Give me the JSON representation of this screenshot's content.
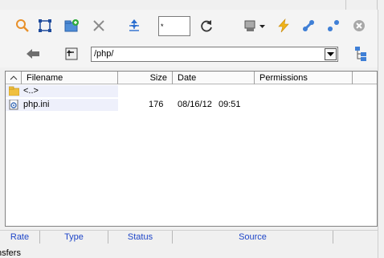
{
  "toolbar": {
    "filter_value": "*",
    "path_value": "/php/"
  },
  "columns": [
    "Filename",
    "Size",
    "Date",
    "Permissions"
  ],
  "files": [
    {
      "name": "<..>",
      "size": "",
      "date": "",
      "time": "",
      "icon": "folder-icon"
    },
    {
      "name": "php.ini",
      "size": "176",
      "date": "08/16/12",
      "time": "09:51",
      "icon": "file-config-icon"
    }
  ],
  "queue": {
    "columns": [
      "Rate",
      "Type",
      "Status",
      "Source"
    ],
    "status_text": "nsfers"
  },
  "colors": {
    "queue_header_text": "#1f46c8",
    "icon_blue": "#3f7fd6",
    "icon_orange": "#f0a020"
  }
}
